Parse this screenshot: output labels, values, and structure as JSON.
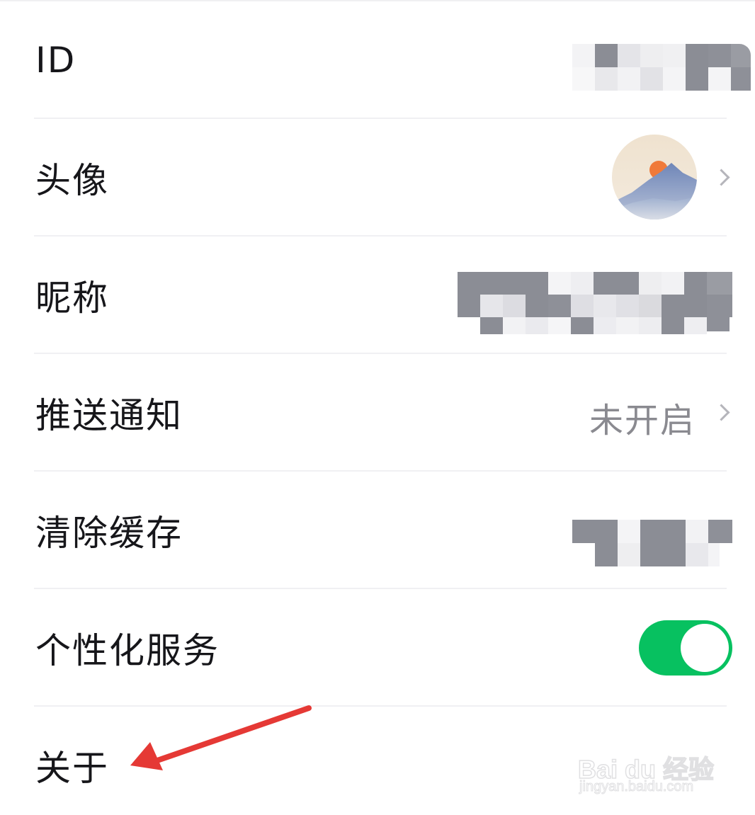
{
  "settings": {
    "rows": [
      {
        "label": "ID"
      },
      {
        "label": "头像"
      },
      {
        "label": "昵称"
      },
      {
        "label": "推送通知",
        "value": "未开启"
      },
      {
        "label": "清除缓存"
      },
      {
        "label": "个性化服务",
        "toggle_on": true
      },
      {
        "label": "关于"
      }
    ]
  },
  "icons": {
    "chevron": "chevron-right-icon",
    "avatar": "landscape-avatar",
    "annotation": "red-arrow"
  },
  "colors": {
    "toggle_on": "#07c160",
    "annotation_arrow": "#e53935",
    "label_text": "#16161a",
    "secondary_text": "#8a8a90"
  },
  "watermark": {
    "brand": "Bai du 经验",
    "url": "jingyan.baidu.com"
  }
}
